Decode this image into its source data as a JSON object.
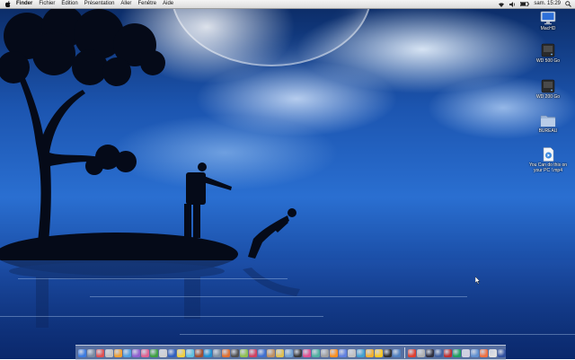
{
  "menubar": {
    "app_name": "Finder",
    "items": [
      "Fichier",
      "Édition",
      "Présentation",
      "Aller",
      "Fenêtre",
      "Aide"
    ],
    "clock": "sam. 15:29"
  },
  "desktop": {
    "icons": [
      {
        "label": "MacHD",
        "icon": "imac-drive-icon"
      },
      {
        "label": "WD 500 Go",
        "icon": "hard-drive-icon"
      },
      {
        "label": "WD 200 Go",
        "icon": "hard-drive-icon"
      },
      {
        "label": "BUREAU",
        "icon": "folder-icon"
      },
      {
        "label": "You Can do this on your PC !.mp4",
        "icon": "video-file-icon"
      }
    ]
  },
  "dock": {
    "icon_colors": [
      "#3b7be0",
      "#7a8aa0",
      "#e05050",
      "#c0c0c0",
      "#f0a030",
      "#50a0e0",
      "#9060d0",
      "#e06090",
      "#40a040",
      "#d0d0d0",
      "#3060c0",
      "#f0d040",
      "#60c0e0",
      "#a05030",
      "#2090d0",
      "#8090a0",
      "#e07030",
      "#505050",
      "#90c050",
      "#d04060",
      "#4070d0",
      "#c09060",
      "#e0c050",
      "#70a0d0",
      "#3a3a3a",
      "#e05090",
      "#50b0a0",
      "#a0a0a0",
      "#ff9020",
      "#6080e0",
      "#c0c0c0",
      "#40a0d0",
      "#f0b030",
      "#ffc820",
      "#303030",
      "#5080c0",
      "#e04030",
      "#b0b0b0",
      "#303040",
      "#4060a0",
      "#c03030",
      "#20a060",
      "#d0d0e0",
      "#6090d0",
      "#f07040",
      "#e0e0e0",
      "#3050a0"
    ]
  }
}
